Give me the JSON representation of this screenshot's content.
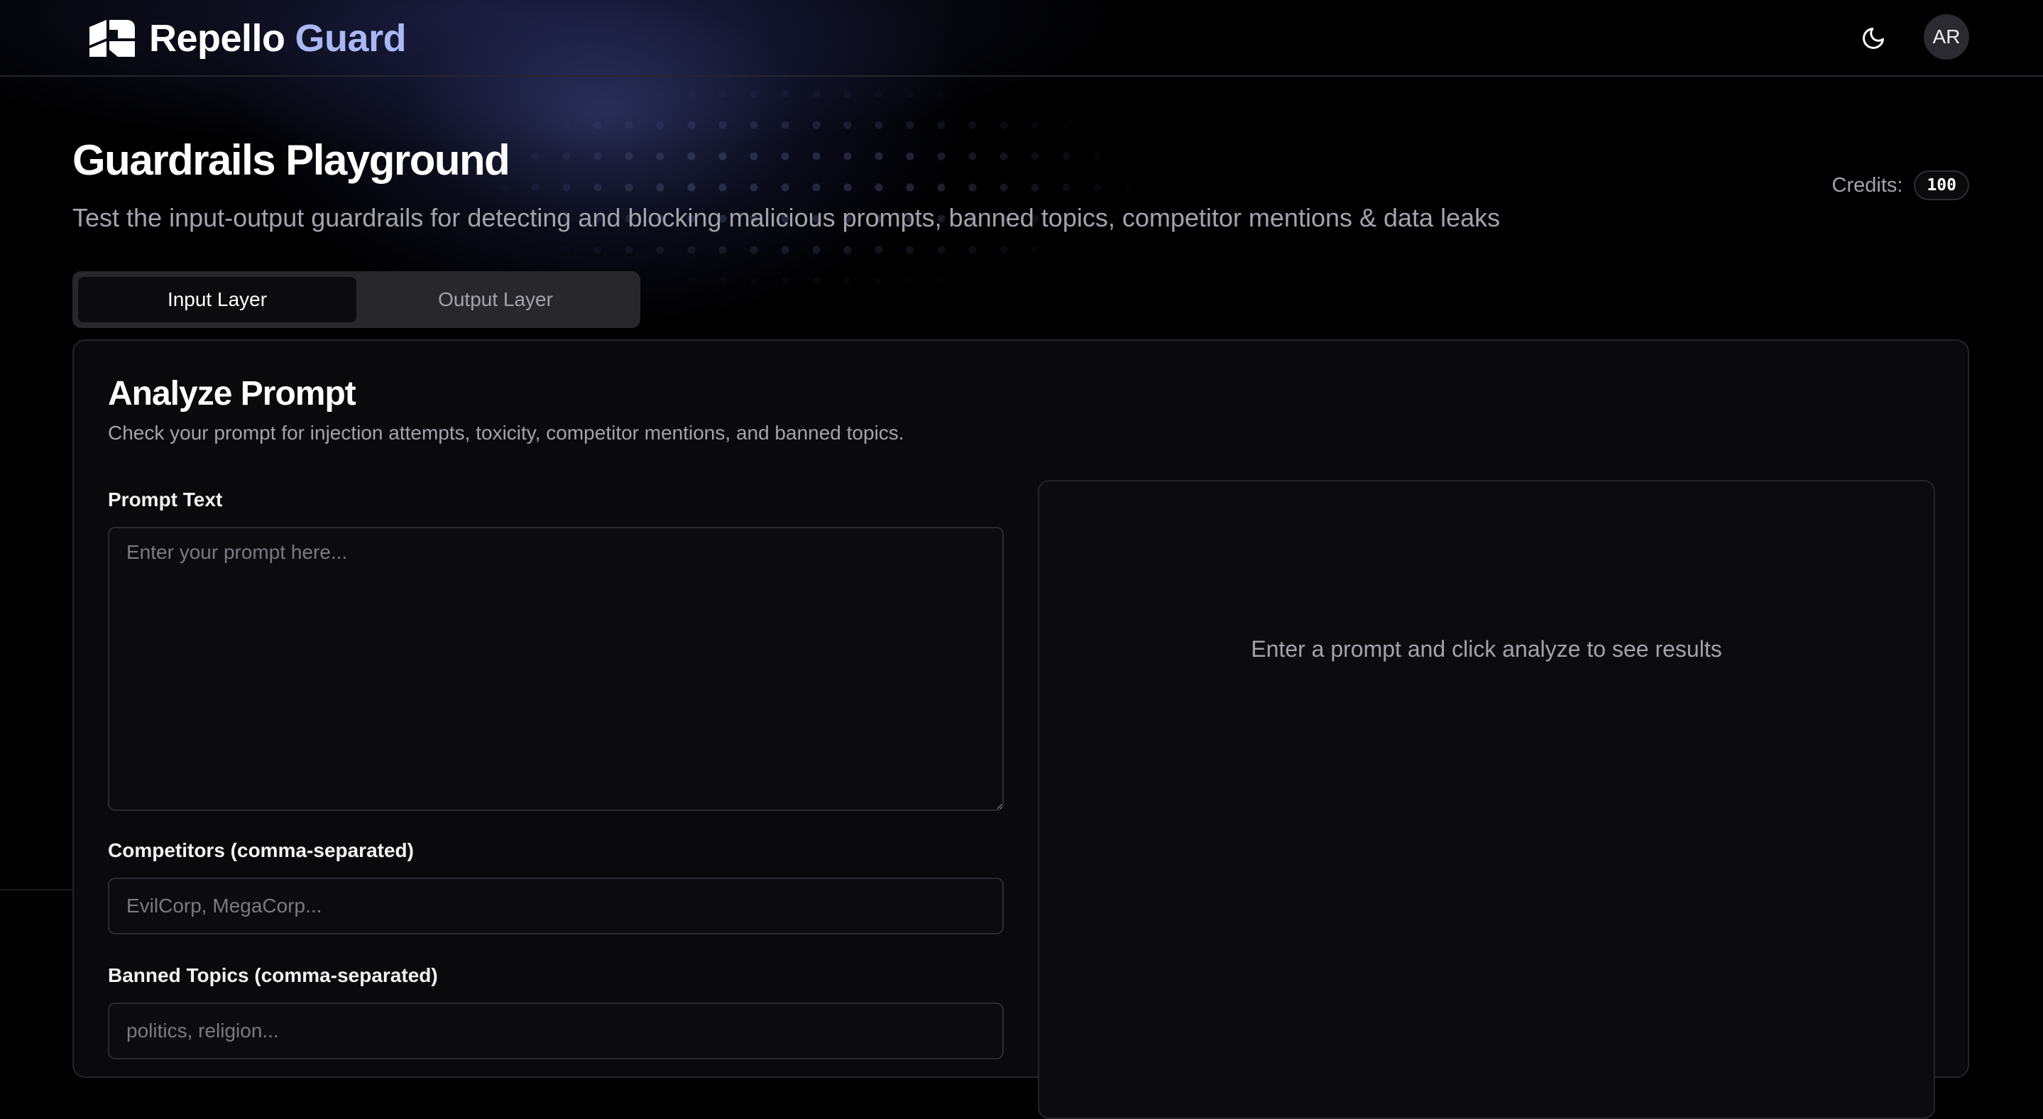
{
  "header": {
    "logo_text_primary": "Repello",
    "logo_text_secondary": "Guard",
    "theme_toggle_icon": "moon-icon",
    "avatar_initials": "AR"
  },
  "page": {
    "title": "Guardrails Playground",
    "subtitle": "Test the input-output guardrails for detecting and blocking malicious prompts, banned topics, competitor mentions & data leaks"
  },
  "credits": {
    "label": "Credits:",
    "value": "100"
  },
  "tabs": [
    {
      "label": "Input Layer",
      "active": true
    },
    {
      "label": "Output Layer",
      "active": false
    }
  ],
  "card": {
    "title": "Analyze Prompt",
    "description": "Check your prompt for injection attempts, toxicity, competitor mentions, and banned topics.",
    "prompt_label": "Prompt Text",
    "prompt_placeholder": "Enter your prompt here...",
    "competitors_label": "Competitors (comma-separated)",
    "competitors_placeholder": "EvilCorp, MegaCorp...",
    "banned_label": "Banned Topics (comma-separated)",
    "banned_placeholder": "politics, religion...",
    "results_placeholder": "Enter a prompt and click analyze to see results"
  },
  "colors": {
    "background": "#000000",
    "card": "#0a0a0c",
    "accent": "#a9b8f5",
    "muted_text": "#a3a3ab",
    "border": "#24242a"
  }
}
